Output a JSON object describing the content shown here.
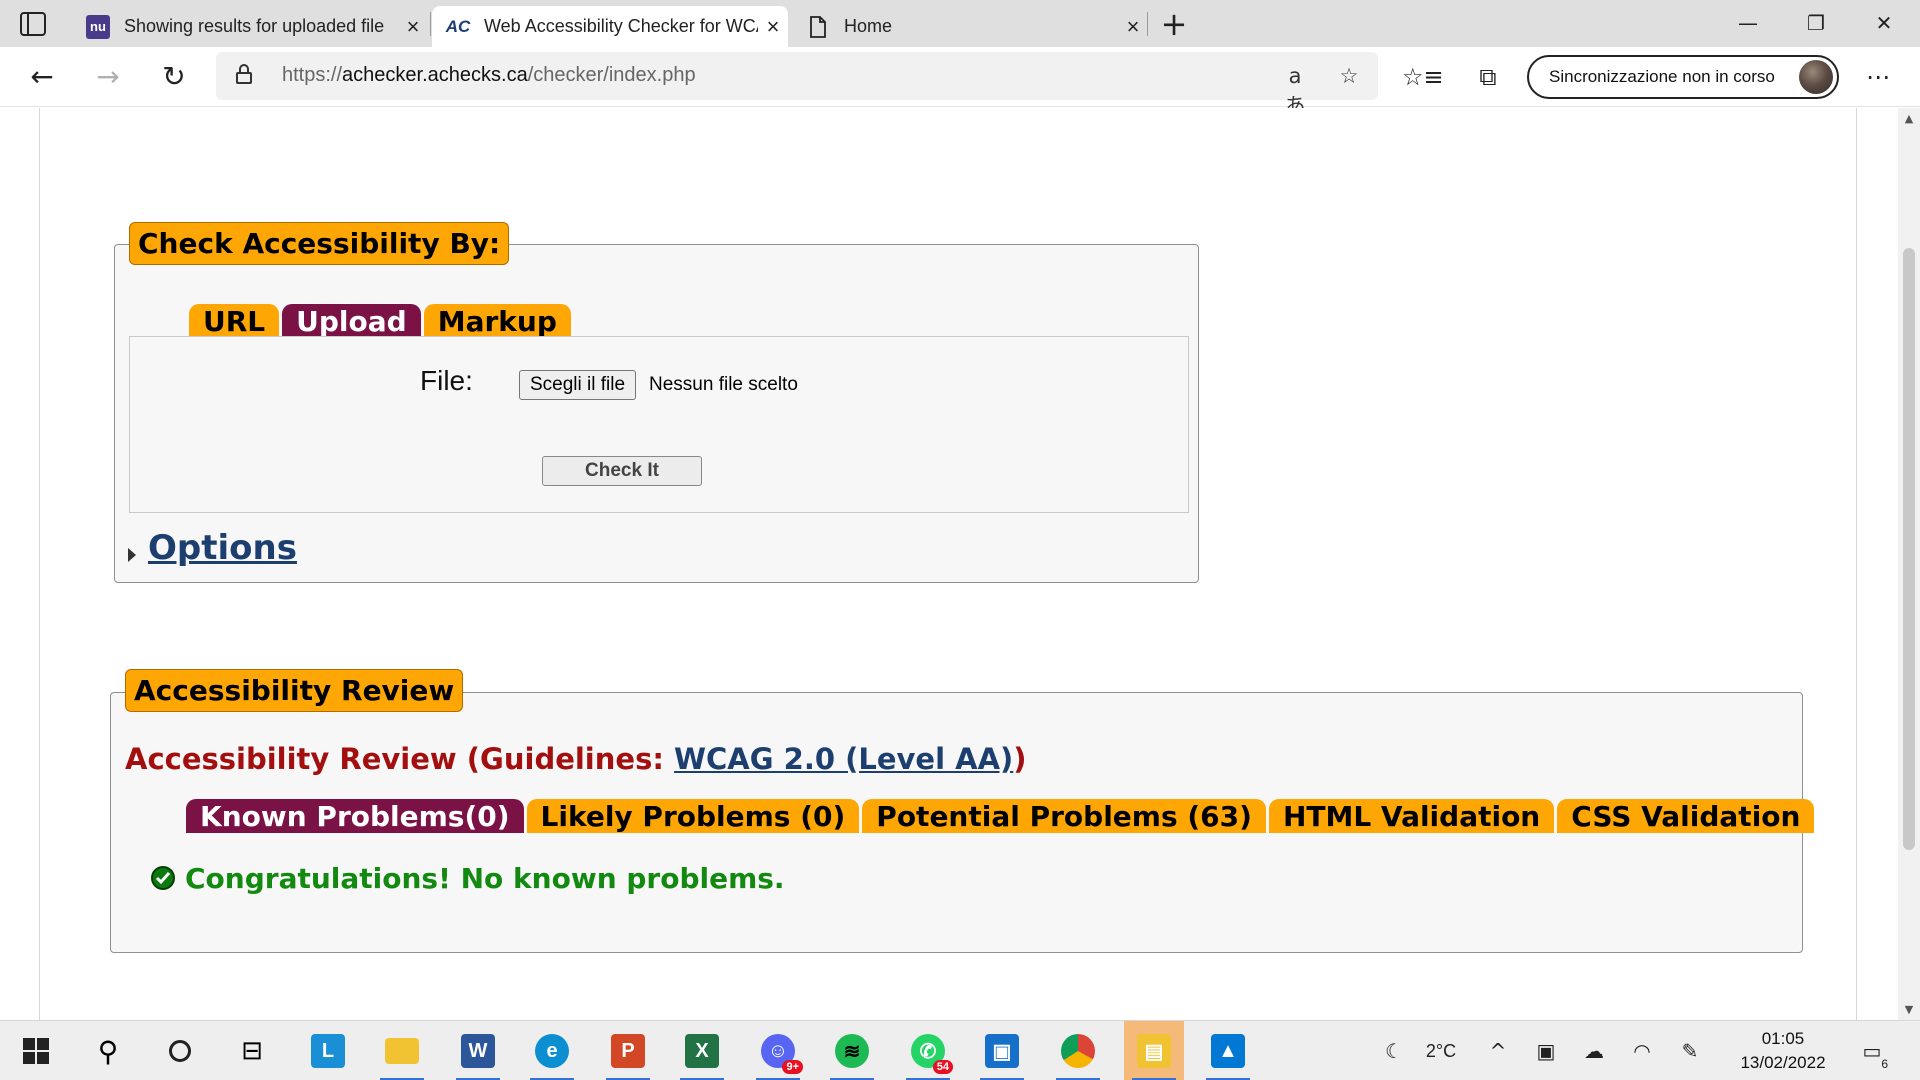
{
  "browser": {
    "tabs": [
      {
        "title": "Showing results for uploaded file",
        "icon": "nu"
      },
      {
        "title": "Web Accessibility Checker for WCAG",
        "icon": "AC"
      },
      {
        "title": "Home",
        "icon": "page-icon"
      }
    ],
    "url_scheme": "https://",
    "url_host": "achecker.achecks.ca",
    "url_path": "/checker/index.php",
    "sync_label": "Sincronizzazione non in corso"
  },
  "check_form": {
    "legend": "Check Accessibility By:",
    "tabs": [
      "URL",
      "Upload",
      "Markup"
    ],
    "selected_tab": "Upload",
    "file_label": "File:",
    "file_button": "Scegli il file",
    "file_status": "Nessun file scelto",
    "check_button": "Check It",
    "options_label": "Options"
  },
  "review": {
    "legend": "Accessibility Review",
    "heading_prefix": "Accessibility Review (Guidelines: ",
    "guideline_link": "WCAG 2.0 (Level AA)",
    "heading_suffix": ")",
    "tabs": [
      "Known Problems(0)",
      "Likely Problems (0)",
      "Potential Problems (63)",
      "HTML Validation",
      "CSS Validation"
    ],
    "selected_tab": "Known Problems(0)",
    "message": "Congratulations! No known problems."
  },
  "taskbar": {
    "weather": "2°C",
    "time": "01:05",
    "date": "13/02/2022",
    "notifications": "6",
    "discord_badge": "9+",
    "whatsapp_badge": "54"
  },
  "colors": {
    "tab_orange": "#fea604",
    "tab_selected": "#7b1246",
    "error_red": "#a30f0f",
    "success_green": "#128a10",
    "link_blue": "#1c3f70"
  }
}
